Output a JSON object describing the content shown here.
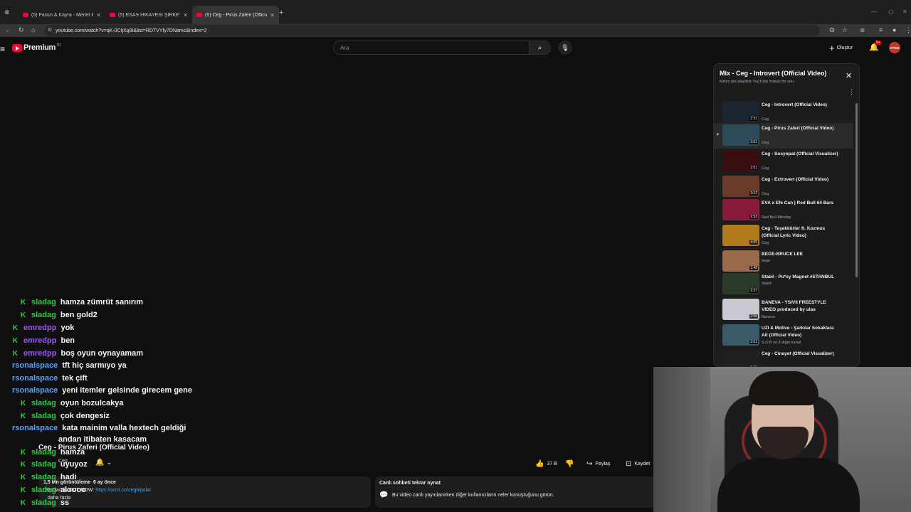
{
  "browser": {
    "tabs": [
      {
        "title": "(5) Farazi & Kayra - Mertel Kavis",
        "active": false
      },
      {
        "title": "(5) ESAS HİKAYESİ ŞİRKETTİR 2...",
        "active": false
      },
      {
        "title": "(5) Ceg - Pirus Zaferi (Official V...",
        "active": true
      }
    ],
    "new_tab": "+",
    "url": "youtube.com/watch?v=qK-0CtjXg8I&list=RDTVYfy7DNamc&index=2",
    "win_min": "—",
    "win_max": "▢",
    "win_close": "✕"
  },
  "masthead": {
    "logo_text": "Premium",
    "country": "TR",
    "search_placeholder": "Ara",
    "create_label": "Oluştur",
    "notif_count": "9+",
    "avatar_text": "APSIK"
  },
  "chat": {
    "messages": [
      {
        "user": "sladag",
        "color": "#2ecc40",
        "badge": true,
        "text": "hamza zümrüt sanırım"
      },
      {
        "user": "sladag",
        "color": "#2ecc40",
        "badge": true,
        "text": "ben gold2"
      },
      {
        "user": "emredpp",
        "color": "#9b59f0",
        "badge": true,
        "text": "yok"
      },
      {
        "user": "emredpp",
        "color": "#9b59f0",
        "badge": true,
        "text": "ben"
      },
      {
        "user": "emredpp",
        "color": "#9b59f0",
        "badge": true,
        "text": "boş oyun oynayamam"
      },
      {
        "user": "rsonalspace",
        "color": "#5aa0ff",
        "badge": false,
        "text": "tft hiç sarmıyo ya"
      },
      {
        "user": "rsonalspace",
        "color": "#5aa0ff",
        "badge": false,
        "text": "tek çift"
      },
      {
        "user": "rsonalspace",
        "color": "#5aa0ff",
        "badge": false,
        "text": "yeni itemler gelsinde girecem gene"
      },
      {
        "user": "sladag",
        "color": "#2ecc40",
        "badge": true,
        "text": "oyun bozulcakya"
      },
      {
        "user": "sladag",
        "color": "#2ecc40",
        "badge": true,
        "text": "çok dengesiz"
      },
      {
        "user": "rsonalspace",
        "color": "#5aa0ff",
        "badge": false,
        "text": "kata mainim valla hextech geldiği"
      },
      {
        "user": "",
        "color": "#5aa0ff",
        "badge": false,
        "text": "andan itibaten kasacam"
      },
      {
        "user": "sladag",
        "color": "#2ecc40",
        "badge": true,
        "text": "hamza"
      },
      {
        "user": "sladag",
        "color": "#2ecc40",
        "badge": true,
        "text": "uyuyoz"
      },
      {
        "user": "sladag",
        "color": "#2ecc40",
        "badge": true,
        "text": "hadi"
      },
      {
        "user": "sladag",
        "color": "#2ecc40",
        "badge": true,
        "text": "aloooo"
      },
      {
        "user": "sladag",
        "color": "#2ecc40",
        "badge": true,
        "text": "ss"
      }
    ]
  },
  "video": {
    "title": "Ceg - Pirus Zaferi (Official Video)",
    "channel": "Ceg",
    "views": "1,5 Mn görüntüleme",
    "age": "6 ay önce",
    "desc_prefix": "\"Bipolar\" is OUT NOW:",
    "desc_link": "https://orcd.co/cegbipolar",
    "more": "daha fazla",
    "likes": "37 B",
    "share": "Paylaş",
    "save": "Kaydet"
  },
  "replay": {
    "heading": "Canlı sohbeti tekrar oynat",
    "subtitle": "Bu video canlı yayınlanırken diğer kullanıcıların neler konuştuğunu görün."
  },
  "playlist": {
    "title": "Mix - Ceg - Introvert (Official Video)",
    "subtitle": "Mixes are playlists YouTube makes for you",
    "items": [
      {
        "title": "Ceg - Introvert (Official Video)",
        "channel": "Ceg",
        "duration": "2:31",
        "current": false,
        "color": "#1b2430"
      },
      {
        "title": "Ceg - Pirus Zaferi (Official Video)",
        "channel": "Ceg",
        "duration": "3:01",
        "current": true,
        "color": "#2b4a5a"
      },
      {
        "title": "Ceg - Sosyopat (Official Visualizer)",
        "channel": "Ceg",
        "duration": "3:01",
        "current": false,
        "color": "#3a0d10"
      },
      {
        "title": "Ceg - Extrovert (Official Video)",
        "channel": "Ceg",
        "duration": "3:22",
        "current": false,
        "color": "#6a3a2a"
      },
      {
        "title": "EVA x Efe Can | Red Bull 64 Bars",
        "channel": "Red Bull Mikstep",
        "duration": "2:53",
        "current": false,
        "color": "#8a1a3a"
      },
      {
        "title": "Ceg - Teşekkürler ft. Kozmos (Official Lyric Video)",
        "channel": "Ceg",
        "duration": "4:05",
        "current": false,
        "color": "#b07a1a"
      },
      {
        "title": "BEGE-BRUCE LEE",
        "channel": "bege",
        "duration": "1:48",
        "current": false,
        "color": "#9a6a4a"
      },
      {
        "title": "Stabil - Pu*sy Magnet #STANBUL",
        "channel": "Stabil",
        "duration": "2:27",
        "current": false,
        "color": "#2a3a2a"
      },
      {
        "title": "BANEVA - YSIVII FREESTYLE VIDEO produced by ulas",
        "channel": "Baneva",
        "duration": "2:59",
        "current": false,
        "color": "#c8c8d0"
      },
      {
        "title": "UZI & Motive - Şarkılar Sokaklara Ait (Official Video)",
        "channel": "S.O.B ve 2 diğer kanal",
        "duration": "3:01",
        "current": false,
        "color": "#3a5a6a"
      },
      {
        "title": "Ceg - Cinayet (Official Visualizer)",
        "channel": "",
        "duration": "2:39",
        "current": false,
        "color": "#202020"
      }
    ]
  }
}
